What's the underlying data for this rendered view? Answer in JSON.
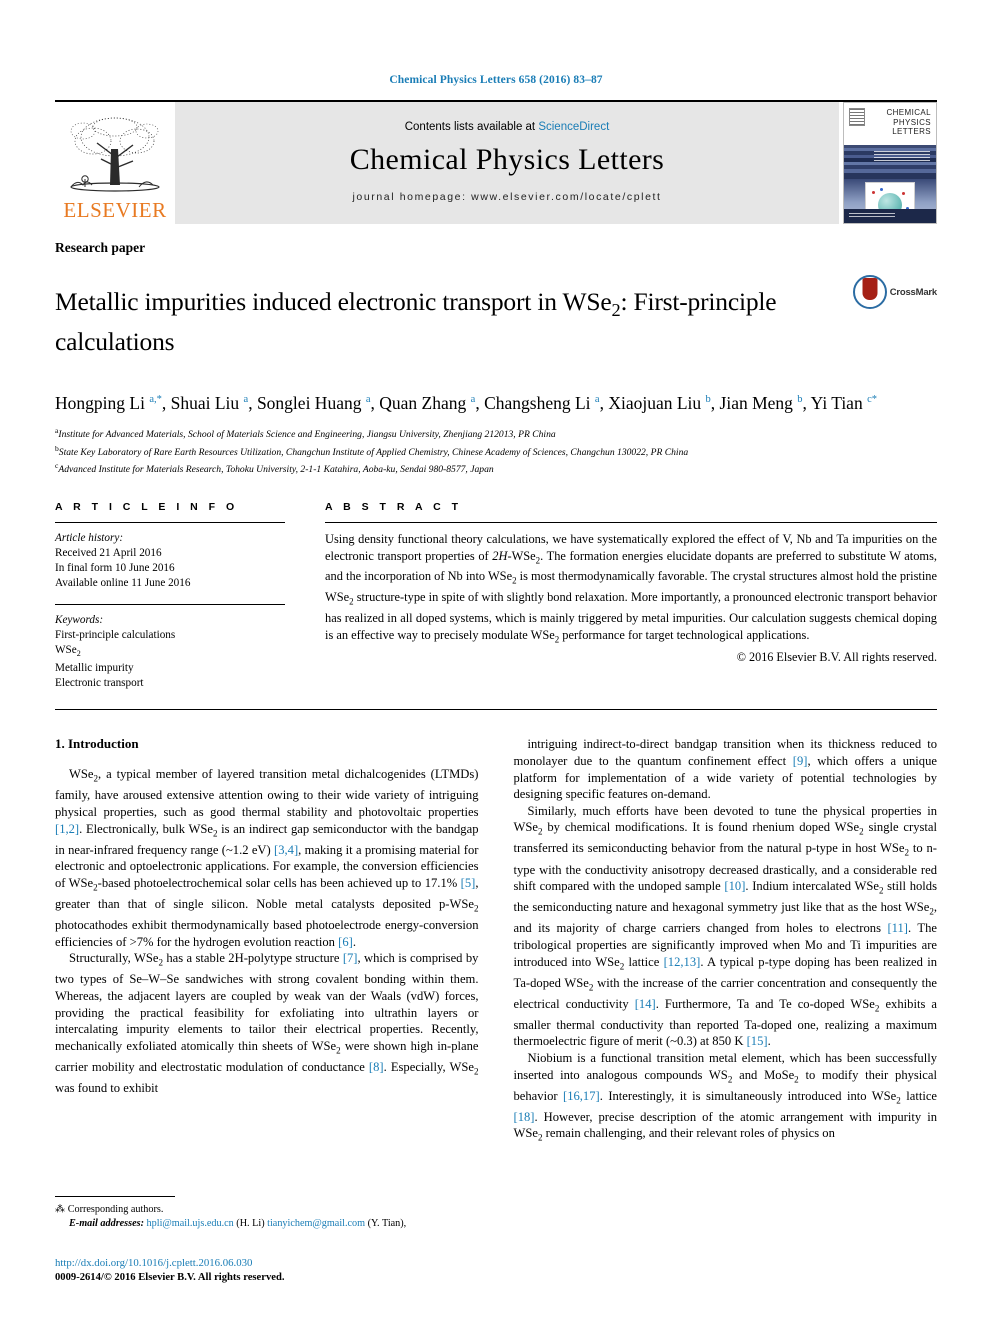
{
  "running_head": "Chemical Physics Letters 658 (2016) 83–87",
  "masthead": {
    "elsevier_wordmark": "ELSEVIER",
    "contents_prefix": "Contents lists available at ",
    "contents_link": "ScienceDirect",
    "journal_title": "Chemical Physics Letters",
    "homepage_label": "journal homepage: www.elsevier.com/locate/cplett",
    "cover_title_line1": "CHEMICAL",
    "cover_title_line2": "PHYSICS",
    "cover_title_line3": "LETTERS"
  },
  "article": {
    "type": "Research paper",
    "title_part1": "Metallic impurities induced electronic transport in WSe",
    "title_sub": "2",
    "title_part2": ": First-principle calculations",
    "crossmark_label": "CrossMark",
    "authors_html": "Hongping Li a,*, Shuai Liu a, Songlei Huang a, Quan Zhang a, Changsheng Li a, Xiaojuan Liu b, Jian Meng b, Yi Tian c*",
    "authors": [
      {
        "name": "Hongping Li",
        "marks": "a,*"
      },
      {
        "name": "Shuai Liu",
        "marks": "a"
      },
      {
        "name": "Songlei Huang",
        "marks": "a"
      },
      {
        "name": "Quan Zhang",
        "marks": "a"
      },
      {
        "name": "Changsheng Li",
        "marks": "a"
      },
      {
        "name": "Xiaojuan Liu",
        "marks": "b"
      },
      {
        "name": "Jian Meng",
        "marks": "b"
      },
      {
        "name": "Yi Tian",
        "marks": "c*"
      }
    ],
    "affiliations": [
      {
        "mark": "a",
        "text": "Institute for Advanced Materials, School of Materials Science and Engineering, Jiangsu University, Zhenjiang 212013, PR China"
      },
      {
        "mark": "b",
        "text": "State Key Laboratory of Rare Earth Resources Utilization, Changchun Institute of Applied Chemistry, Chinese Academy of Sciences, Changchun 130022, PR China"
      },
      {
        "mark": "c",
        "text": "Advanced Institute for Materials Research, Tohoku University, 2-1-1 Katahira, Aoba-ku, Sendai 980-8577, Japan"
      }
    ]
  },
  "article_info": {
    "heading": "A R T I C L E   I N F O",
    "history_label": "Article history:",
    "history": [
      "Received 21 April 2016",
      "In final form 10 June 2016",
      "Available online 11 June 2016"
    ],
    "keywords_label": "Keywords:",
    "keywords": [
      "First-principle calculations",
      "WSe2",
      "Metallic impurity",
      "Electronic transport"
    ]
  },
  "abstract": {
    "heading": "A B S T R A C T",
    "text": "Using density functional theory calculations, we have systematically explored the effect of V, Nb and Ta impurities on the electronic transport properties of 2H-WSe₂. The formation energies elucidate dopants are preferred to substitute W atoms, and the incorporation of Nb into WSe₂ is most thermodynamically favorable. The crystal structures almost hold the pristine WSe₂ structure-type in spite of with slightly bond relaxation. More importantly, a pronounced electronic transport behavior has realized in all doped systems, which is mainly triggered by metal impurities. Our calculation suggests chemical doping is an effective way to precisely modulate WSe₂ performance for target technological applications.",
    "copyright": "© 2016 Elsevier B.V. All rights reserved."
  },
  "body": {
    "section1_title": "1. Introduction",
    "left_paragraphs": [
      "WSe₂, a typical member of layered transition metal dichalcogenides (LTMDs) family, have aroused extensive attention owing to their wide variety of intriguing physical properties, such as good thermal stability and photovoltaic properties [1,2]. Electronically, bulk WSe₂ is an indirect gap semiconductor with the bandgap in near-infrared frequency range (~1.2 eV) [3,4], making it a promising material for electronic and optoelectronic applications. For example, the conversion efficiencies of WSe₂-based photoelectrochemical solar cells has been achieved up to 17.1% [5], greater than that of single silicon. Noble metal catalysts deposited p-WSe₂ photocathodes exhibit thermodynamically based photoelectrode energy-conversion efficiencies of >7% for the hydrogen evolution reaction [6].",
      "Structurally, WSe₂ has a stable 2H-polytype structure [7], which is comprised by two types of Se–W–Se sandwiches with strong covalent bonding within them. Whereas, the adjacent layers are coupled by weak van der Waals (vdW) forces, providing the practical feasibility for exfoliating into ultrathin layers or intercalating impurity elements to tailor their electrical properties. Recently, mechanically exfoliated atomically thin sheets of WSe₂ were shown high in-plane carrier mobility and electrostatic modulation of conductance [8]. Especially, WSe₂ was found to exhibit"
    ],
    "right_paragraphs": [
      "intriguing indirect-to-direct bandgap transition when its thickness reduced to monolayer due to the quantum confinement effect [9], which offers a unique platform for implementation of a wide variety of potential technologies by designing specific features on-demand.",
      "Similarly, much efforts have been devoted to tune the physical properties in WSe₂ by chemical modifications. It is found rhenium doped WSe₂ single crystal transferred its semiconducting behavior from the natural p-type in host WSe₂ to n-type with the conductivity anisotropy decreased drastically, and a considerable red shift compared with the undoped sample [10]. Indium intercalated WSe₂ still holds the semiconducting nature and hexagonal symmetry just like that as the host WSe₂, and its majority of charge carriers changed from holes to electrons [11]. The tribological properties are significantly improved when Mo and Ti impurities are introduced into WSe₂ lattice [12,13]. A typical p-type doping has been realized in Ta-doped WSe₂ with the increase of the carrier concentration and consequently the electrical conductivity [14]. Furthermore, Ta and Te co-doped WSe₂ exhibits a smaller thermal conductivity than reported Ta-doped one, realizing a maximum thermoelectric figure of merit (~0.3) at 850 K [15].",
      "Niobium is a functional transition metal element, which has been successfully inserted into analogous compounds WS₂ and MoSe₂ to modify their physical behavior [16,17]. Interestingly, it is simultaneously introduced into WSe₂ lattice [18]. However, precise description of the atomic arrangement with impurity in WSe₂ remain challenging, and their relevant roles of physics on"
    ]
  },
  "footnote": {
    "corresponding": "Corresponding authors.",
    "email_label": "E-mail addresses:",
    "email1": "hpli@mail.ujs.edu.cn",
    "email1_who": "(H. Li)",
    "email2": "tianyichem@gmail.com",
    "email2_who": "(Y. Tian),"
  },
  "doi_block": {
    "doi": "http://dx.doi.org/10.1016/j.cplett.2016.06.030",
    "issn": "0009-2614/© 2016 Elsevier B.V. All rights reserved."
  },
  "colors": {
    "link_blue": "#1a7db6",
    "elsevier_orange": "#e87a22",
    "masthead_gray": "#e6e6e6"
  }
}
